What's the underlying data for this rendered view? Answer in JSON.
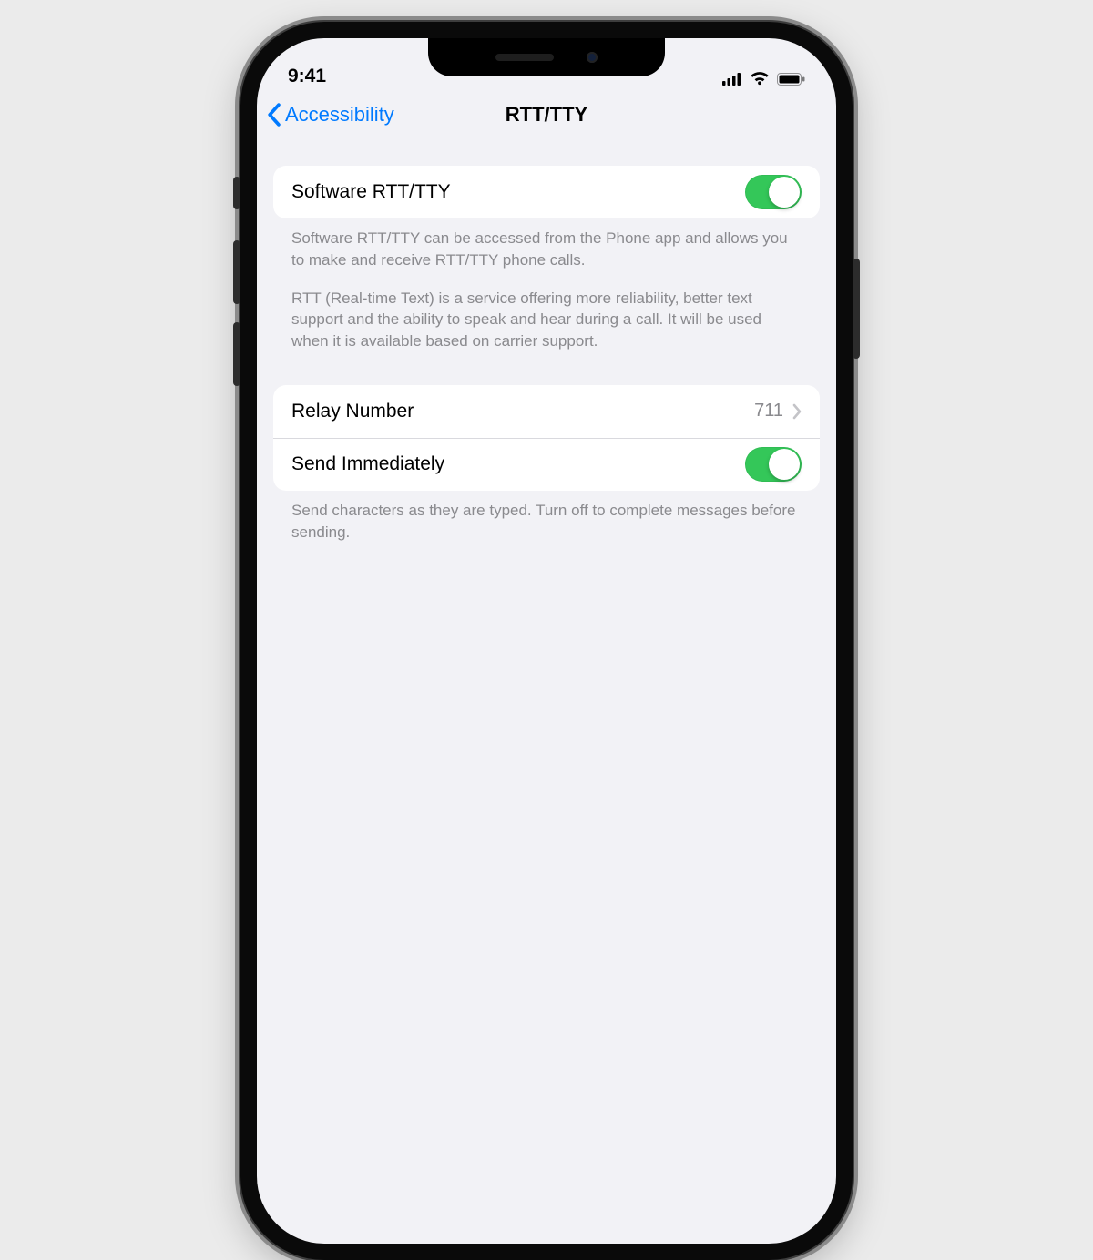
{
  "status": {
    "time": "9:41"
  },
  "nav": {
    "back_label": "Accessibility",
    "title": "RTT/TTY"
  },
  "group1": {
    "software_label": "Software RTT/TTY",
    "software_on": true,
    "footer_p1": "Software RTT/TTY can be accessed from the Phone app and allows you to make and receive RTT/TTY phone calls.",
    "footer_p2": "RTT (Real-time Text) is a service offering more reliability, better text support and the ability to speak and hear during a call. It will be used when it is available based on carrier support."
  },
  "group2": {
    "relay_label": "Relay Number",
    "relay_value": "711",
    "send_label": "Send Immediately",
    "send_on": true,
    "footer": "Send characters as they are typed. Turn off to complete messages before sending."
  }
}
